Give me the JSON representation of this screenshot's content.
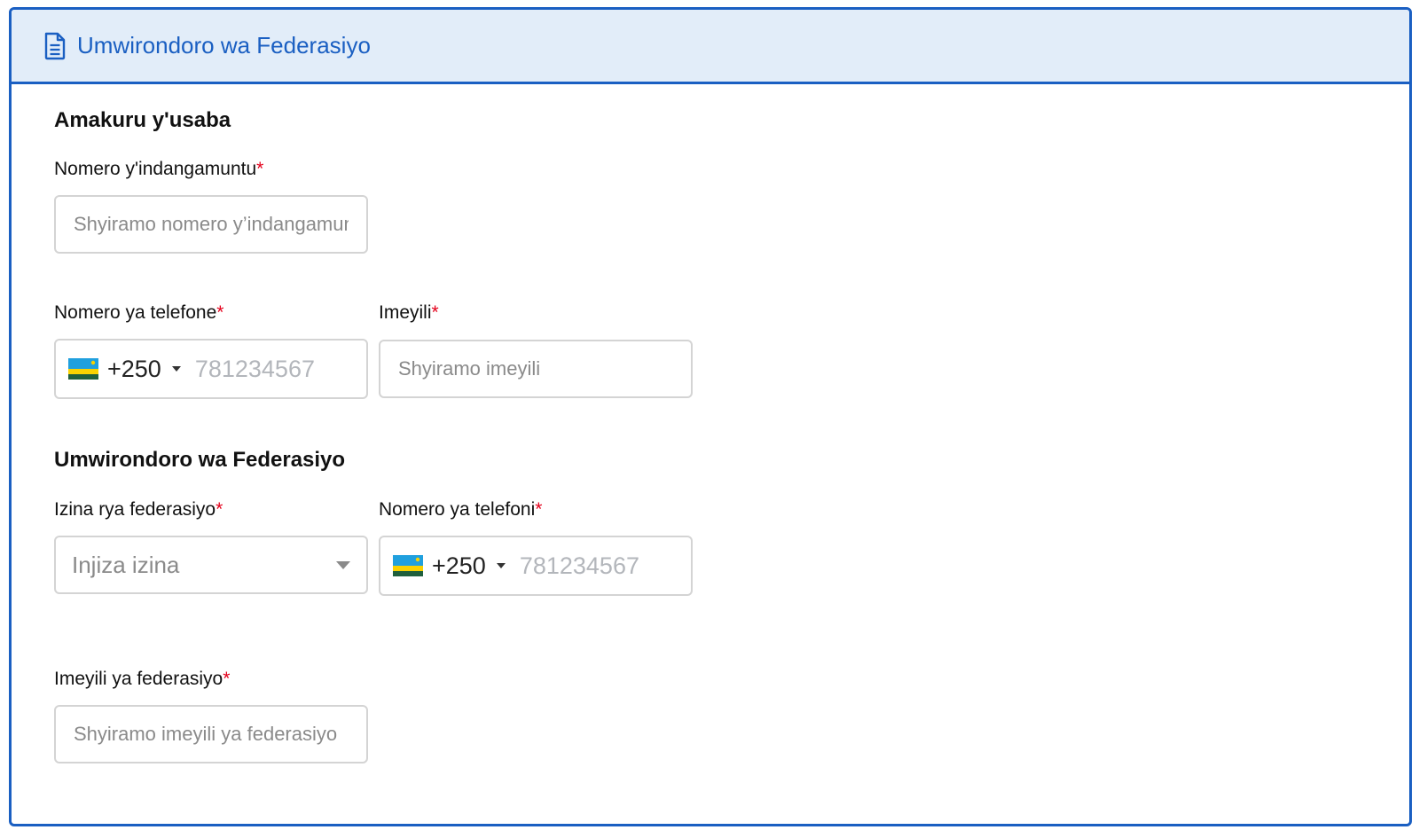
{
  "header": {
    "title": "Umwirondoro wa Federasiyo",
    "icon": "document-icon"
  },
  "applicant": {
    "section_title": "Amakuru y'usaba",
    "id_number": {
      "label": "Nomero y'indangamuntu",
      "required": "*",
      "placeholder": "Shyiramo nomero y’indangamuntu"
    },
    "phone": {
      "label": "Nomero ya telefone",
      "required": "*",
      "dial_code": "+250",
      "placeholder": "781234567"
    },
    "email": {
      "label": "Imeyili",
      "required": "*",
      "placeholder": "Shyiramo imeyili"
    }
  },
  "federation": {
    "section_title": "Umwirondoro wa Federasiyo",
    "name": {
      "label": "Izina rya federasiyo",
      "required": "*",
      "placeholder": "Injiza izina"
    },
    "phone": {
      "label": "Nomero ya telefoni",
      "required": "*",
      "dial_code": "+250",
      "placeholder": "781234567"
    },
    "email": {
      "label": "Imeyili ya federasiyo",
      "required": "*",
      "placeholder": "Shyiramo imeyili ya federasiyo"
    }
  },
  "colors": {
    "accent": "#1a5fc2",
    "header_bg": "#e2edf9",
    "required": "#e4001b"
  }
}
